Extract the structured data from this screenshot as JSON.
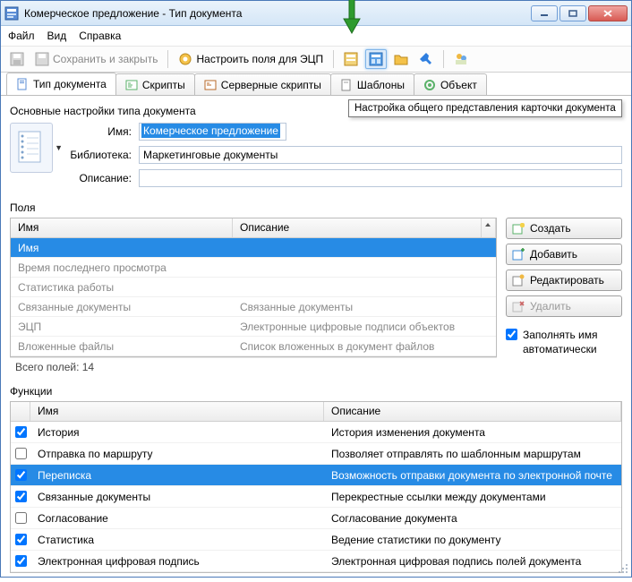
{
  "window": {
    "title": "Комерческое предложение - Тип документа",
    "minimize": "_",
    "maximize": "□",
    "close": "✕"
  },
  "menu": {
    "file": "Файл",
    "view": "Вид",
    "help": "Справка"
  },
  "toolbar": {
    "save_close": "Сохранить и закрыть",
    "configure_ets": "Настроить поля для ЭЦП",
    "tooltip_layout": "Настройка общего представления карточки документа"
  },
  "tabs": {
    "doc_type": "Тип документа",
    "scripts": "Скрипты",
    "server_scripts": "Серверные скрипты",
    "templates": "Шаблоны",
    "object": "Объект"
  },
  "section_main": "Основные настройки типа документа",
  "form": {
    "name_label": "Имя:",
    "name_value": "Комерческое предложение",
    "library_label": "Библиотека:",
    "library_value": "Маркетинговые документы",
    "description_label": "Описание:",
    "description_value": ""
  },
  "fields": {
    "title": "Поля",
    "col_name": "Имя",
    "col_desc": "Описание",
    "rows": [
      {
        "name": "Имя",
        "desc": ""
      },
      {
        "name": "Время последнего просмотра",
        "desc": ""
      },
      {
        "name": "Статистика работы",
        "desc": ""
      },
      {
        "name": "Связанные документы",
        "desc": "Связанные документы"
      },
      {
        "name": "ЭЦП",
        "desc": "Электронные цифровые подписи объектов"
      },
      {
        "name": "Вложенные файлы",
        "desc": "Список вложенных в документ файлов"
      }
    ],
    "footer": "Всего полей: 14",
    "side": {
      "create": "Создать",
      "add": "Добавить",
      "edit": "Редактировать",
      "delete": "Удалить",
      "autofill": "Заполнять имя автоматически"
    }
  },
  "functions": {
    "title": "Функции",
    "col_name": "Имя",
    "col_desc": "Описание",
    "rows": [
      {
        "checked": true,
        "name": "История",
        "desc": "История изменения документа"
      },
      {
        "checked": false,
        "name": "Отправка по маршруту",
        "desc": "Позволяет отправлять по шаблонным маршрутам"
      },
      {
        "checked": true,
        "name": "Переписка",
        "desc": "Возможность отправки документа по электронной почте"
      },
      {
        "checked": true,
        "name": "Связанные документы",
        "desc": "Перекрестные ссылки между документами"
      },
      {
        "checked": false,
        "name": "Согласование",
        "desc": "Согласование документа"
      },
      {
        "checked": true,
        "name": "Статистика",
        "desc": "Ведение статистики по документу"
      },
      {
        "checked": true,
        "name": "Электронная цифровая подпись",
        "desc": "Электронная цифровая подпись полей документа"
      }
    ]
  }
}
